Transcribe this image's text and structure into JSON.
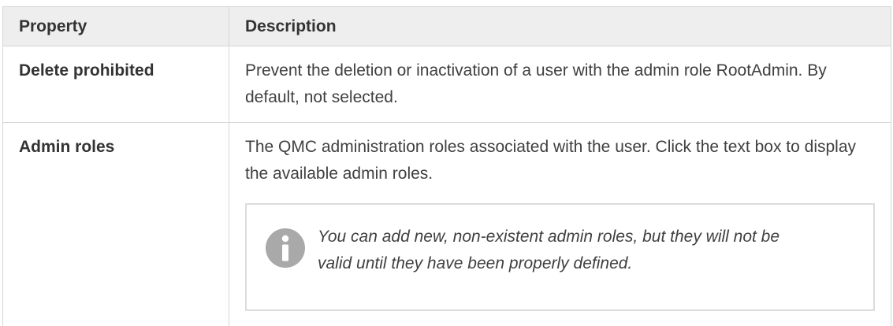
{
  "table": {
    "headers": [
      "Property",
      "Description"
    ],
    "rows": [
      {
        "property": "Delete prohibited",
        "description": "Prevent the deletion or inactivation of a user with the admin role RootAdmin. By default, not selected."
      },
      {
        "property": "Admin roles",
        "description": "The QMC administration roles associated with the user. Click the text box to display the available admin roles.",
        "note": {
          "icon": "info-icon",
          "text": "You can add new, non-existent admin roles, but they will not be valid until they have been properly defined."
        }
      }
    ]
  },
  "colors": {
    "header_bg": "#eeeeee",
    "border": "#d6d6d6",
    "icon": "#a9a9a9"
  }
}
